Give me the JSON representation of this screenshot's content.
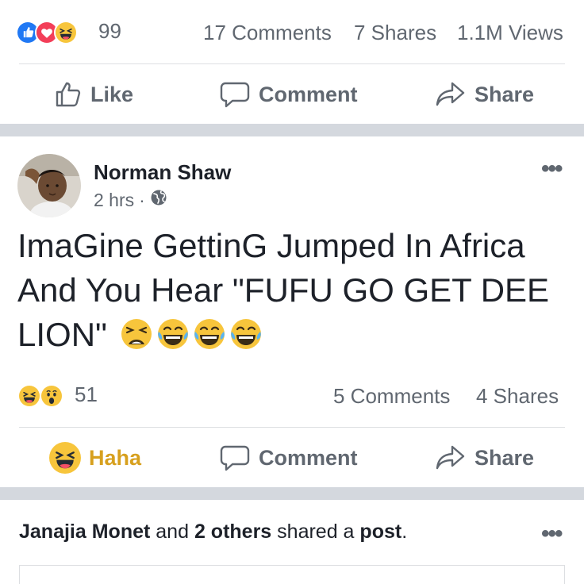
{
  "post_top": {
    "reactions_count": "99",
    "comments": "17 Comments",
    "shares": "7 Shares",
    "views": "1.1M Views",
    "actions": {
      "like": "Like",
      "comment": "Comment",
      "share": "Share"
    }
  },
  "post_main": {
    "author": "Norman Shaw",
    "time": "2 hrs",
    "dot": "·",
    "more": "•••",
    "text": "ImaGine GettinG Jumped In Africa And You Hear \"FUFU GO GET DEE LION\"",
    "reactions_count": "51",
    "comments": "5 Comments",
    "shares": "4 Shares",
    "actions": {
      "haha": "Haha",
      "comment": "Comment",
      "share": "Share"
    }
  },
  "post_shared": {
    "actor": "Janajia Monet",
    "and": "and",
    "others": "2 others",
    "verb": "shared a",
    "object": "post",
    "period": ".",
    "more": "•••"
  },
  "colors": {
    "like_blue": "#2078f4",
    "love_red": "#f33e58",
    "haha_yellow": "#f7c53c",
    "haha_text": "#d7a01e",
    "gray_text": "#606770",
    "separator": "#d4d8de"
  },
  "icons": [
    "like-reaction-icon",
    "love-reaction-icon",
    "haha-reaction-icon",
    "wow-reaction-icon",
    "thumbs-up-icon",
    "comment-bubble-icon",
    "share-arrow-icon",
    "globe-icon",
    "tired-face-emoji",
    "laughing-tears-emoji"
  ]
}
